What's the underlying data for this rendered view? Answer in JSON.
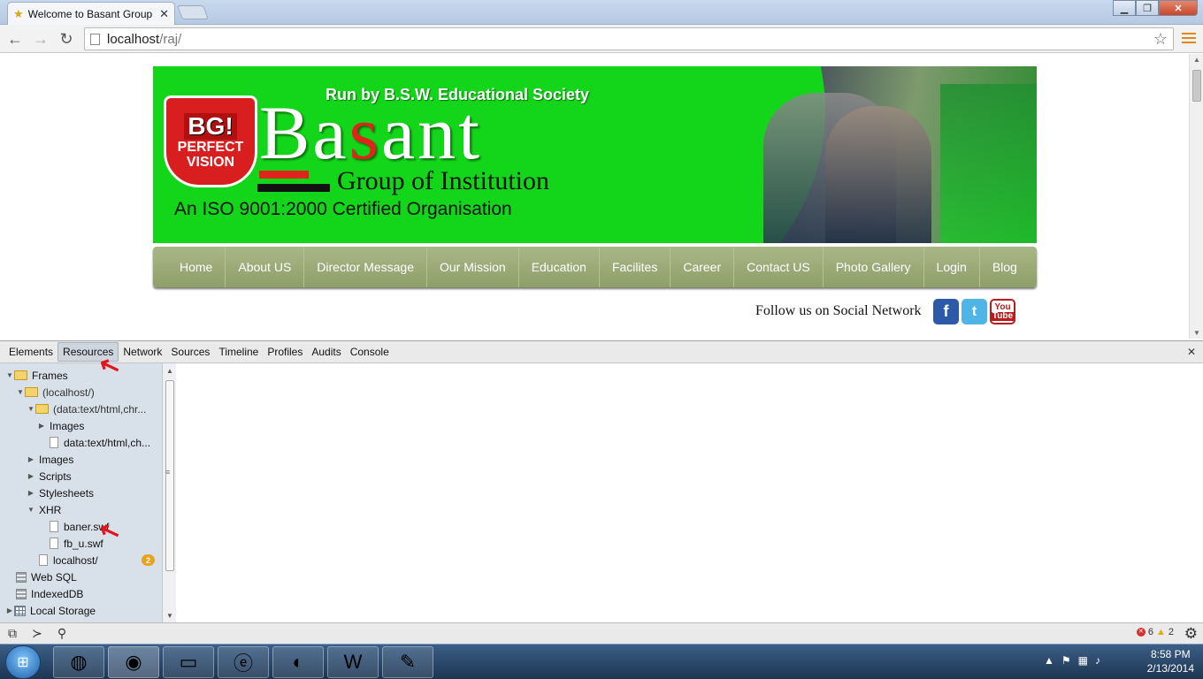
{
  "browser": {
    "tab_title": "Welcome to Basant Group",
    "tab_close": "✕",
    "url_host": "localhost",
    "url_path": "/raj/"
  },
  "site": {
    "run_by": "Run by B.S.W. Educational Society",
    "logo_line1": "BG!",
    "logo_line2": "PERFECT",
    "logo_line3": "VISION",
    "brand_pre": "Ba",
    "brand_s": "s",
    "brand_post": "ant",
    "group": "Group of Institution",
    "iso": "An ISO 9001:2000 Certified Organisation",
    "nav": [
      "Home",
      "About US",
      "Director Message",
      "Our Mission",
      "Education",
      "Facilites",
      "Career",
      "Contact US",
      "Photo Gallery",
      "Login",
      "Blog"
    ],
    "follow": "Follow us on Social Network",
    "social_fb": "f",
    "social_tw": "t",
    "social_yt_top": "You",
    "social_yt_bottom": "Tube"
  },
  "devtools": {
    "tabs": [
      "Elements",
      "Resources",
      "Network",
      "Sources",
      "Timeline",
      "Profiles",
      "Audits",
      "Console"
    ],
    "active_tab": "Resources",
    "tree": {
      "frames": "Frames",
      "localhost_frame": "(localhost/)",
      "data_frame": "(data:text/html,chr...",
      "images_sub": "Images",
      "data_doc": "data:text/html,ch...",
      "images": "Images",
      "scripts": "Scripts",
      "stylesheets": "Stylesheets",
      "xhr": "XHR",
      "baner": "baner.swf",
      "fb_u": "fb_u.swf",
      "localhost_doc": "localhost/",
      "localhost_badge": "2",
      "web_sql": "Web SQL",
      "indexeddb": "IndexedDB",
      "local_storage": "Local Storage"
    },
    "error_count": "6",
    "warning_count": "2"
  },
  "taskbar": {
    "time": "8:58 PM",
    "date": "2/13/2014"
  },
  "colors": {
    "banner_green": "#13d61a",
    "nav_olive": "#9aaa76",
    "annotation_red": "#e0161c"
  }
}
